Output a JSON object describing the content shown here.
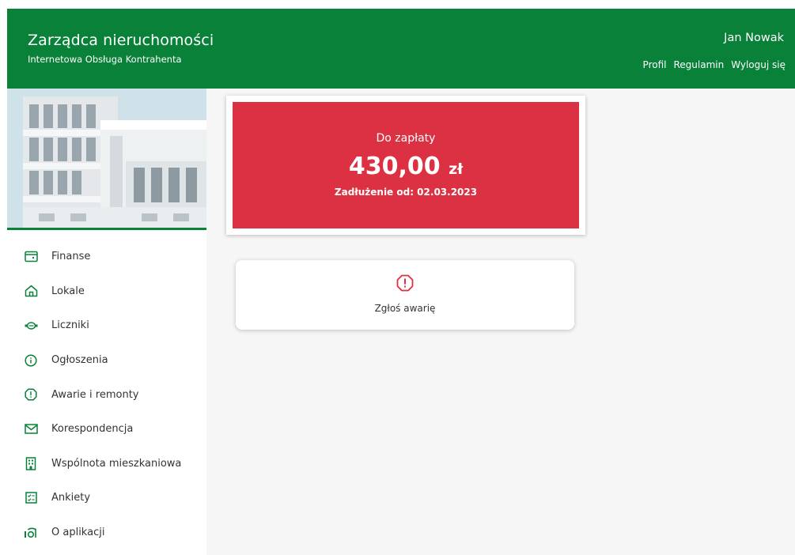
{
  "header": {
    "title": "Zarządca nieruchomości",
    "subtitle": "Internetowa Obsługa Kontrahenta",
    "user_name": "Jan Nowak",
    "nav": [
      "Profil",
      "Regulamin",
      "Wyloguj się"
    ]
  },
  "colors": {
    "brand_green": "#098139",
    "alert_red": "#dc3143",
    "background": "#f6f6f6"
  },
  "sidebar": {
    "items": [
      {
        "label": "Finanse",
        "icon": "wallet-icon"
      },
      {
        "label": "Lokale",
        "icon": "home-icon"
      },
      {
        "label": "Liczniki",
        "icon": "meter-icon"
      },
      {
        "label": "Ogłoszenia",
        "icon": "info-icon"
      },
      {
        "label": "Awarie i remonty",
        "icon": "warning-icon"
      },
      {
        "label": "Korespondencja",
        "icon": "envelope-icon"
      },
      {
        "label": "Wspólnota mieszkaniowa",
        "icon": "building-icon"
      },
      {
        "label": "Ankiety",
        "icon": "checklist-icon"
      },
      {
        "label": "O aplikacji",
        "icon": "about-icon"
      }
    ]
  },
  "payment": {
    "label": "Do zapłaty",
    "amount": "430,00",
    "currency": "zł",
    "debt_since": "Zadłużenie od: 02.03.2023"
  },
  "report": {
    "label": "Zgłoś awarię",
    "icon": "warning-icon"
  }
}
